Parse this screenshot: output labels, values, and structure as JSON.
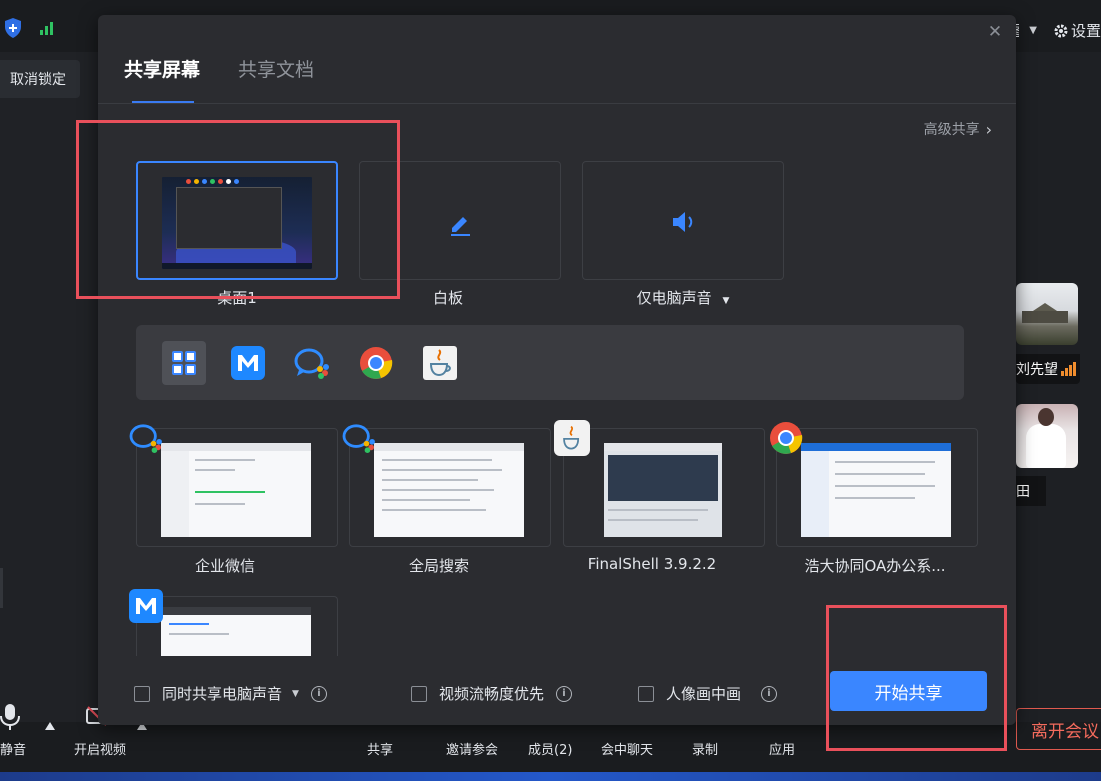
{
  "top_bar": {
    "partial_text": "图",
    "settings_label": "设置"
  },
  "side": {
    "unlock_label": "取消锁定"
  },
  "participants": [
    {
      "name": "刘先望"
    },
    {
      "name": "田"
    }
  ],
  "dialog": {
    "tabs": [
      {
        "label": "共享屏幕",
        "active": true
      },
      {
        "label": "共享文档",
        "active": false
      }
    ],
    "advanced_label": "高级共享",
    "options": [
      {
        "label": "桌面1",
        "selected": true,
        "icon": "desktop-thumbnail"
      },
      {
        "label": "白板",
        "selected": false,
        "icon": "pen-icon"
      },
      {
        "label": "仅电脑声音",
        "selected": false,
        "icon": "speaker-icon"
      }
    ],
    "app_filters": [
      {
        "name": "all-apps",
        "icon": "grid-icon",
        "active": true
      },
      {
        "name": "tencent-meeting",
        "icon": "m-logo-icon",
        "active": false
      },
      {
        "name": "wecom",
        "icon": "wecom-icon",
        "active": false
      },
      {
        "name": "chrome",
        "icon": "chrome-icon",
        "active": false
      },
      {
        "name": "java",
        "icon": "java-icon",
        "active": false
      }
    ],
    "windows": [
      {
        "label": "企业微信",
        "badge": "wecom-icon"
      },
      {
        "label": "全局搜索",
        "badge": "wecom-icon"
      },
      {
        "label": "FinalShell 3.9.2.2",
        "badge": "java-icon"
      },
      {
        "label": "浩大协同OA办公系...",
        "badge": "chrome-icon"
      },
      {
        "label": "",
        "badge": "m-logo-icon"
      }
    ],
    "footer": {
      "share_audio": "同时共享电脑声音",
      "video_smooth": "视频流畅度优先",
      "pip": "人像画中画",
      "start_label": "开始共享"
    }
  },
  "toolbar": {
    "mute": "静音",
    "video": "开启视频",
    "share": "共享",
    "invite": "邀请参会",
    "members": "成员(2)",
    "chat": "会中聊天",
    "record": "录制",
    "apps": "应用",
    "leave": "离开会议"
  },
  "colors": {
    "accent": "#3a86ff",
    "annotation": "#e9505b",
    "leave": "#f46b5d"
  }
}
